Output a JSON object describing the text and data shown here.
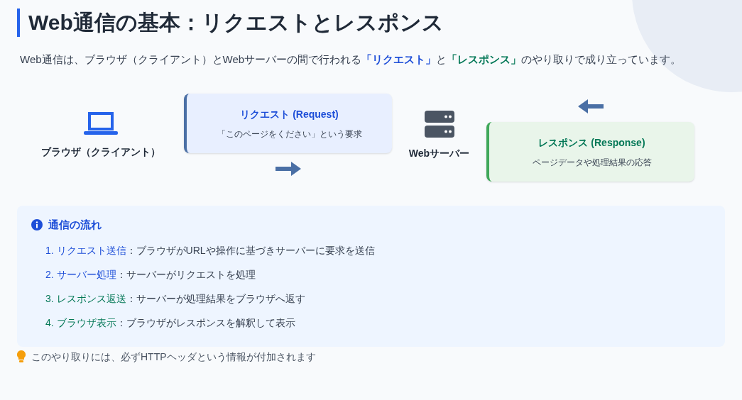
{
  "title": "Web通信の基本：リクエストとレスポンス",
  "intro": [
    {
      "kind": "plain",
      "text": "Web通信は、ブラウザ（クライアント）とWebサーバーの間で行われる"
    },
    {
      "kind": "request",
      "text": "「リクエスト」"
    },
    {
      "kind": "plain",
      "text": "と"
    },
    {
      "kind": "response",
      "text": "「レスポンス」"
    },
    {
      "kind": "plain",
      "text": "のやり取りで成り立っています。"
    }
  ],
  "diagram": {
    "client": "ブラウザ（クライアント）",
    "server": "Webサーバー",
    "request": {
      "title": "リクエスト (Request)",
      "description": "「このページをください」という要求"
    },
    "response": {
      "title": "レスポンス (Response)",
      "description": "ページデータや処理結果の応答"
    }
  },
  "flow": {
    "title": "通信の流れ",
    "steps": [
      {
        "label": "1. リクエスト送信",
        "text": "：ブラウザがURLや操作に基づきサーバーに要求を送信",
        "color": "#1d4ed8"
      },
      {
        "label": "2. サーバー処理",
        "text": "：サーバーがリクエストを処理",
        "color": "#1d4ed8"
      },
      {
        "label": "3. レスポンス返送",
        "text": "：サーバーが処理結果をブラウザへ返す",
        "color": "#047857"
      },
      {
        "label": "4. ブラウザ表示",
        "text": "：ブラウザがレスポンスを解釈して表示",
        "color": "#047857"
      }
    ]
  },
  "note": "このやり取りには、必ずHTTPヘッダという情報が付加されます"
}
